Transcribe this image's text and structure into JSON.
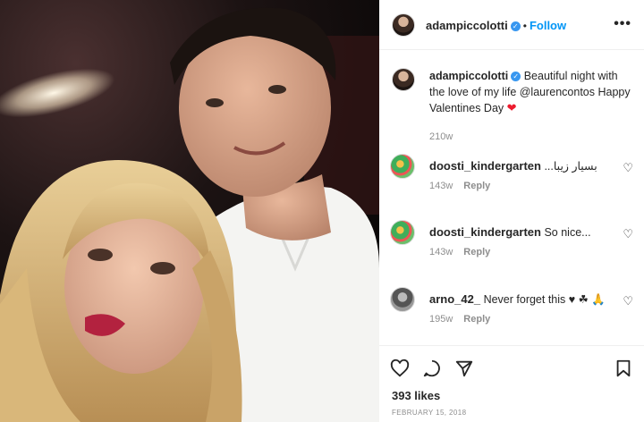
{
  "post": {
    "author": "adampiccolotti",
    "follow_label": "Follow",
    "more_label": "•••",
    "separator": "•",
    "verified_icon": "verified-badge-icon"
  },
  "caption": {
    "author": "adampiccolotti",
    "text": "Beautiful night with the love of my life @laurencontos Happy Valentines Day",
    "heart": "❤",
    "time": "210w"
  },
  "comments": [
    {
      "user": "doosti_kindergarten",
      "text": "...بسيار زيبا",
      "time": "143w",
      "reply": "Reply"
    },
    {
      "user": "doosti_kindergarten",
      "text": "So nice...",
      "time": "143w",
      "reply": "Reply"
    },
    {
      "user": "arno_42_",
      "text": "Never forget this ♥ ☘ 🙏",
      "time": "195w",
      "reply": "Reply"
    }
  ],
  "footer": {
    "likes": "393 likes",
    "date": "FEBRUARY 15, 2018"
  },
  "colors": {
    "accent": "#0095f6",
    "verified": "#3897f0",
    "heart": "#ed1b2e",
    "muted": "#8e8e8e"
  }
}
